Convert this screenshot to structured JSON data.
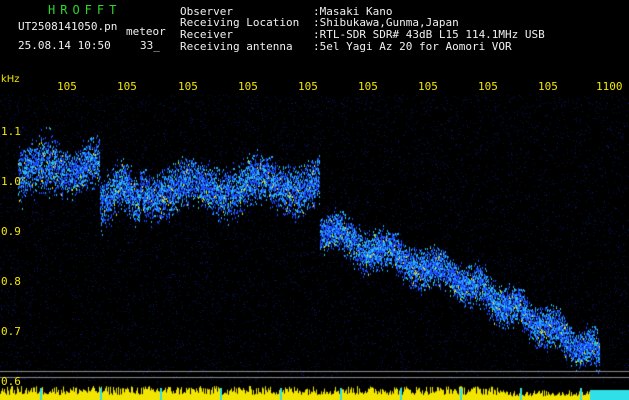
{
  "header": {
    "brand": "HROFFT",
    "filename": "UT2508141050.pn",
    "file_tag": "meteor",
    "datetime": "25.08.14 10:50",
    "counter": "33_",
    "info": [
      {
        "label": "Observer",
        "value": ":Masaki Kano"
      },
      {
        "label": "Receiving Location",
        "value": ":Shibukawa,Gunma,Japan"
      },
      {
        "label": "Receiver",
        "value": ":RTL-SDR SDR# 43dB L15 114.1MHz USB"
      },
      {
        "label": "Receiving antenna",
        "value": ":5el Yagi Az 20 for Aomori VOR"
      }
    ]
  },
  "spectrogram": {
    "y_unit": "kHz",
    "x_tick_labels": [
      "105",
      "105",
      "105",
      "105",
      "105",
      "105",
      "105",
      "105",
      "105",
      "1100"
    ],
    "y_tick_labels": [
      "1.1",
      "1.0",
      "0.9",
      "0.8",
      "0.7",
      "0.6"
    ],
    "colors": {
      "background": "#000000",
      "noise": "#06104a",
      "signal_low": "#1a4cff",
      "signal_mid": "#2bd3c8",
      "signal_high": "#f2e600",
      "marker_line": "#8a8a8a",
      "axis_text": "#f2e600",
      "brand_text": "#2ed52e"
    }
  }
}
